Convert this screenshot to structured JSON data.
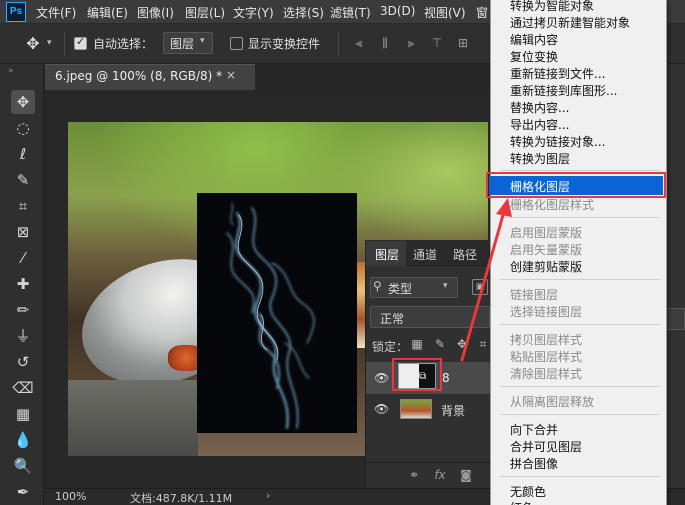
{
  "app": {
    "logo": "Ps"
  },
  "menubar": {
    "items": [
      "文件(F)",
      "编辑(E)",
      "图像(I)",
      "图层(L)",
      "文字(Y)",
      "选择(S)",
      "滤镜(T)",
      "3D(D)",
      "视图(V)",
      "窗"
    ]
  },
  "options_bar": {
    "auto_select_label": "自动选择：",
    "auto_select_value": "图层",
    "show_transform_label": "显示变换控件"
  },
  "document": {
    "tab_label": "6.jpeg @ 100% (8, RGB/8) *",
    "close_glyph": "×"
  },
  "layers_panel": {
    "tabs": [
      "图层",
      "通道",
      "路径"
    ],
    "filter_label": "类型",
    "blend_mode": "正常",
    "lock_label": "锁定：",
    "layers": [
      {
        "name": "8",
        "selected": true
      },
      {
        "name": "背景",
        "selected": false
      }
    ],
    "footer_fx": "fx"
  },
  "status_bar": {
    "zoom": "100%",
    "doc_size": "文档:487.8K/1.11M",
    "arrow": "›"
  },
  "context_menu": {
    "items_group1": [
      "转换为智能对象",
      "通过拷贝新建智能对象",
      "编辑内容",
      "复位变换",
      "重新链接到文件...",
      "重新链接到库图形...",
      "替换内容...",
      "导出内容...",
      "转换为链接对象...",
      "转换为图层"
    ],
    "highlighted": "栅格化图层",
    "rasterize_style": "栅格化图层样式",
    "items_group2": [
      "启用图层蒙版",
      "启用矢量蒙版",
      "创建剪贴蒙版"
    ],
    "items_group3": [
      "链接图层",
      "选择链接图层"
    ],
    "items_group4": [
      "拷贝图层样式",
      "粘贴图层样式",
      "清除图层样式"
    ],
    "release_isolation": "从隔离图层释放",
    "items_group5": [
      "向下合并",
      "合并可见图层",
      "拼合图像"
    ],
    "no_color": "无颜色",
    "red_partial": "红色"
  },
  "colors": {
    "highlight": "#0a64d6",
    "annotation_red": "#e8383a"
  }
}
